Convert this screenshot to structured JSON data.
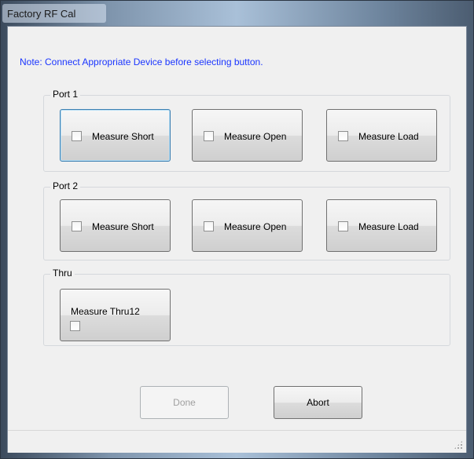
{
  "window": {
    "title": "Factory RF Cal"
  },
  "note": "Note: Connect Appropriate Device before selecting button.",
  "groups": [
    {
      "label": "Port 1",
      "buttons": [
        "Measure Short",
        "Measure Open",
        "Measure Load"
      ]
    },
    {
      "label": "Port 2",
      "buttons": [
        "Measure Short",
        "Measure Open",
        "Measure Load"
      ]
    },
    {
      "label": "Thru",
      "buttons": [
        "Measure Thru12"
      ]
    }
  ],
  "actions": {
    "done": "Done",
    "abort": "Abort"
  },
  "colors": {
    "note_text": "#1a35ff",
    "focus_border": "#3c7fb1"
  }
}
